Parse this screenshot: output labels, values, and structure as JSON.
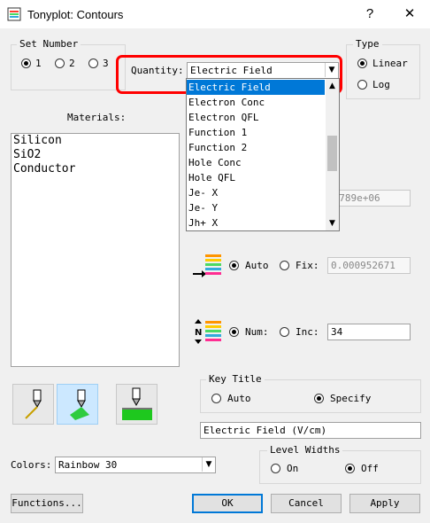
{
  "window": {
    "title": "Tonyplot: Contours",
    "help": "?",
    "close": "✕"
  },
  "set_number": {
    "label": "Set Number",
    "options": [
      {
        "label": "1",
        "selected": true
      },
      {
        "label": "2",
        "selected": false
      },
      {
        "label": "3",
        "selected": false
      }
    ]
  },
  "quantity": {
    "label": "Quantity:",
    "value": "Electric Field",
    "options": [
      "Electric Field",
      "Electron Conc",
      "Electron QFL",
      "Function 1",
      "Function 2",
      "Hole Conc",
      "Hole QFL",
      "Je- X",
      "Je- Y",
      "Jh+ X"
    ],
    "highlight_color": "#ff0000"
  },
  "type": {
    "label": "Type",
    "options": [
      {
        "label": "Linear",
        "selected": true
      },
      {
        "label": "Log",
        "selected": false
      }
    ]
  },
  "materials": {
    "label": "Materials:",
    "items": [
      "Silicon",
      "SiO2",
      "Conductor"
    ]
  },
  "fix_value_hidden": "57789e+06",
  "levels": {
    "auto_label": "Auto",
    "fix_label": "Fix:",
    "fix_value": "0.000952671",
    "num_label": "Num:",
    "inc_label": "Inc:",
    "num_value": "34"
  },
  "key_title": {
    "label": "Key Title",
    "options": [
      {
        "label": "Auto",
        "selected": false
      },
      {
        "label": "Specify",
        "selected": true
      }
    ],
    "value": "Electric Field (V/cm)"
  },
  "colors": {
    "label": "Colors:",
    "value": "Rainbow 30"
  },
  "level_widths": {
    "label": "Level Widths",
    "options": [
      {
        "label": "On",
        "selected": false
      },
      {
        "label": "Off",
        "selected": true
      }
    ]
  },
  "buttons": {
    "functions": "Functions...",
    "ok": "OK",
    "cancel": "Cancel",
    "apply": "Apply"
  },
  "palette_colors": [
    "#ff3b30",
    "#ff9500",
    "#ffcc00",
    "#4cd964",
    "#34aadc",
    "#5856d6",
    "#ff2d92"
  ]
}
